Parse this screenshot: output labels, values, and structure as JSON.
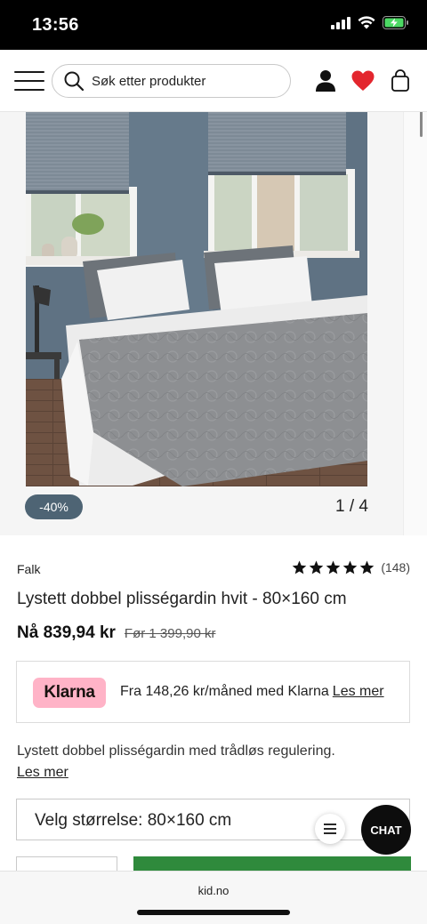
{
  "status_bar": {
    "time": "13:56"
  },
  "header": {
    "search_placeholder": "Søk etter produkter",
    "icons": [
      "menu-icon",
      "search-icon",
      "account-icon",
      "wishlist-heart-icon",
      "shopping-bag-icon"
    ],
    "wishlist_color": "#e3262e"
  },
  "gallery": {
    "discount_badge": "-40%",
    "counter": "1 / 4",
    "image_description": "bedroom-photo"
  },
  "product": {
    "brand": "Falk",
    "rating_stars": 5,
    "review_count": "(148)",
    "title": "Lystett dobbel plisségardin hvit - 80×160 cm",
    "price_now": "Nå 839,94 kr",
    "price_before": "Før 1 399,90 kr"
  },
  "klarna": {
    "logo_text": "Klarna",
    "text": "Fra 148,26 kr/måned med Klarna",
    "link": "Les mer",
    "brand_color": "#ffb3c7"
  },
  "description": {
    "text": "Lystett dobbel plisségardin med trådløs regulering.",
    "link": "Les mer"
  },
  "size_selector": {
    "label": "Velg størrelse: 80×160 cm"
  },
  "chat_button": {
    "label": "CHAT"
  },
  "browser": {
    "url": "kid.no"
  },
  "colors": {
    "accent_green": "#2f8a3c",
    "badge_bg": "#4e6474"
  }
}
